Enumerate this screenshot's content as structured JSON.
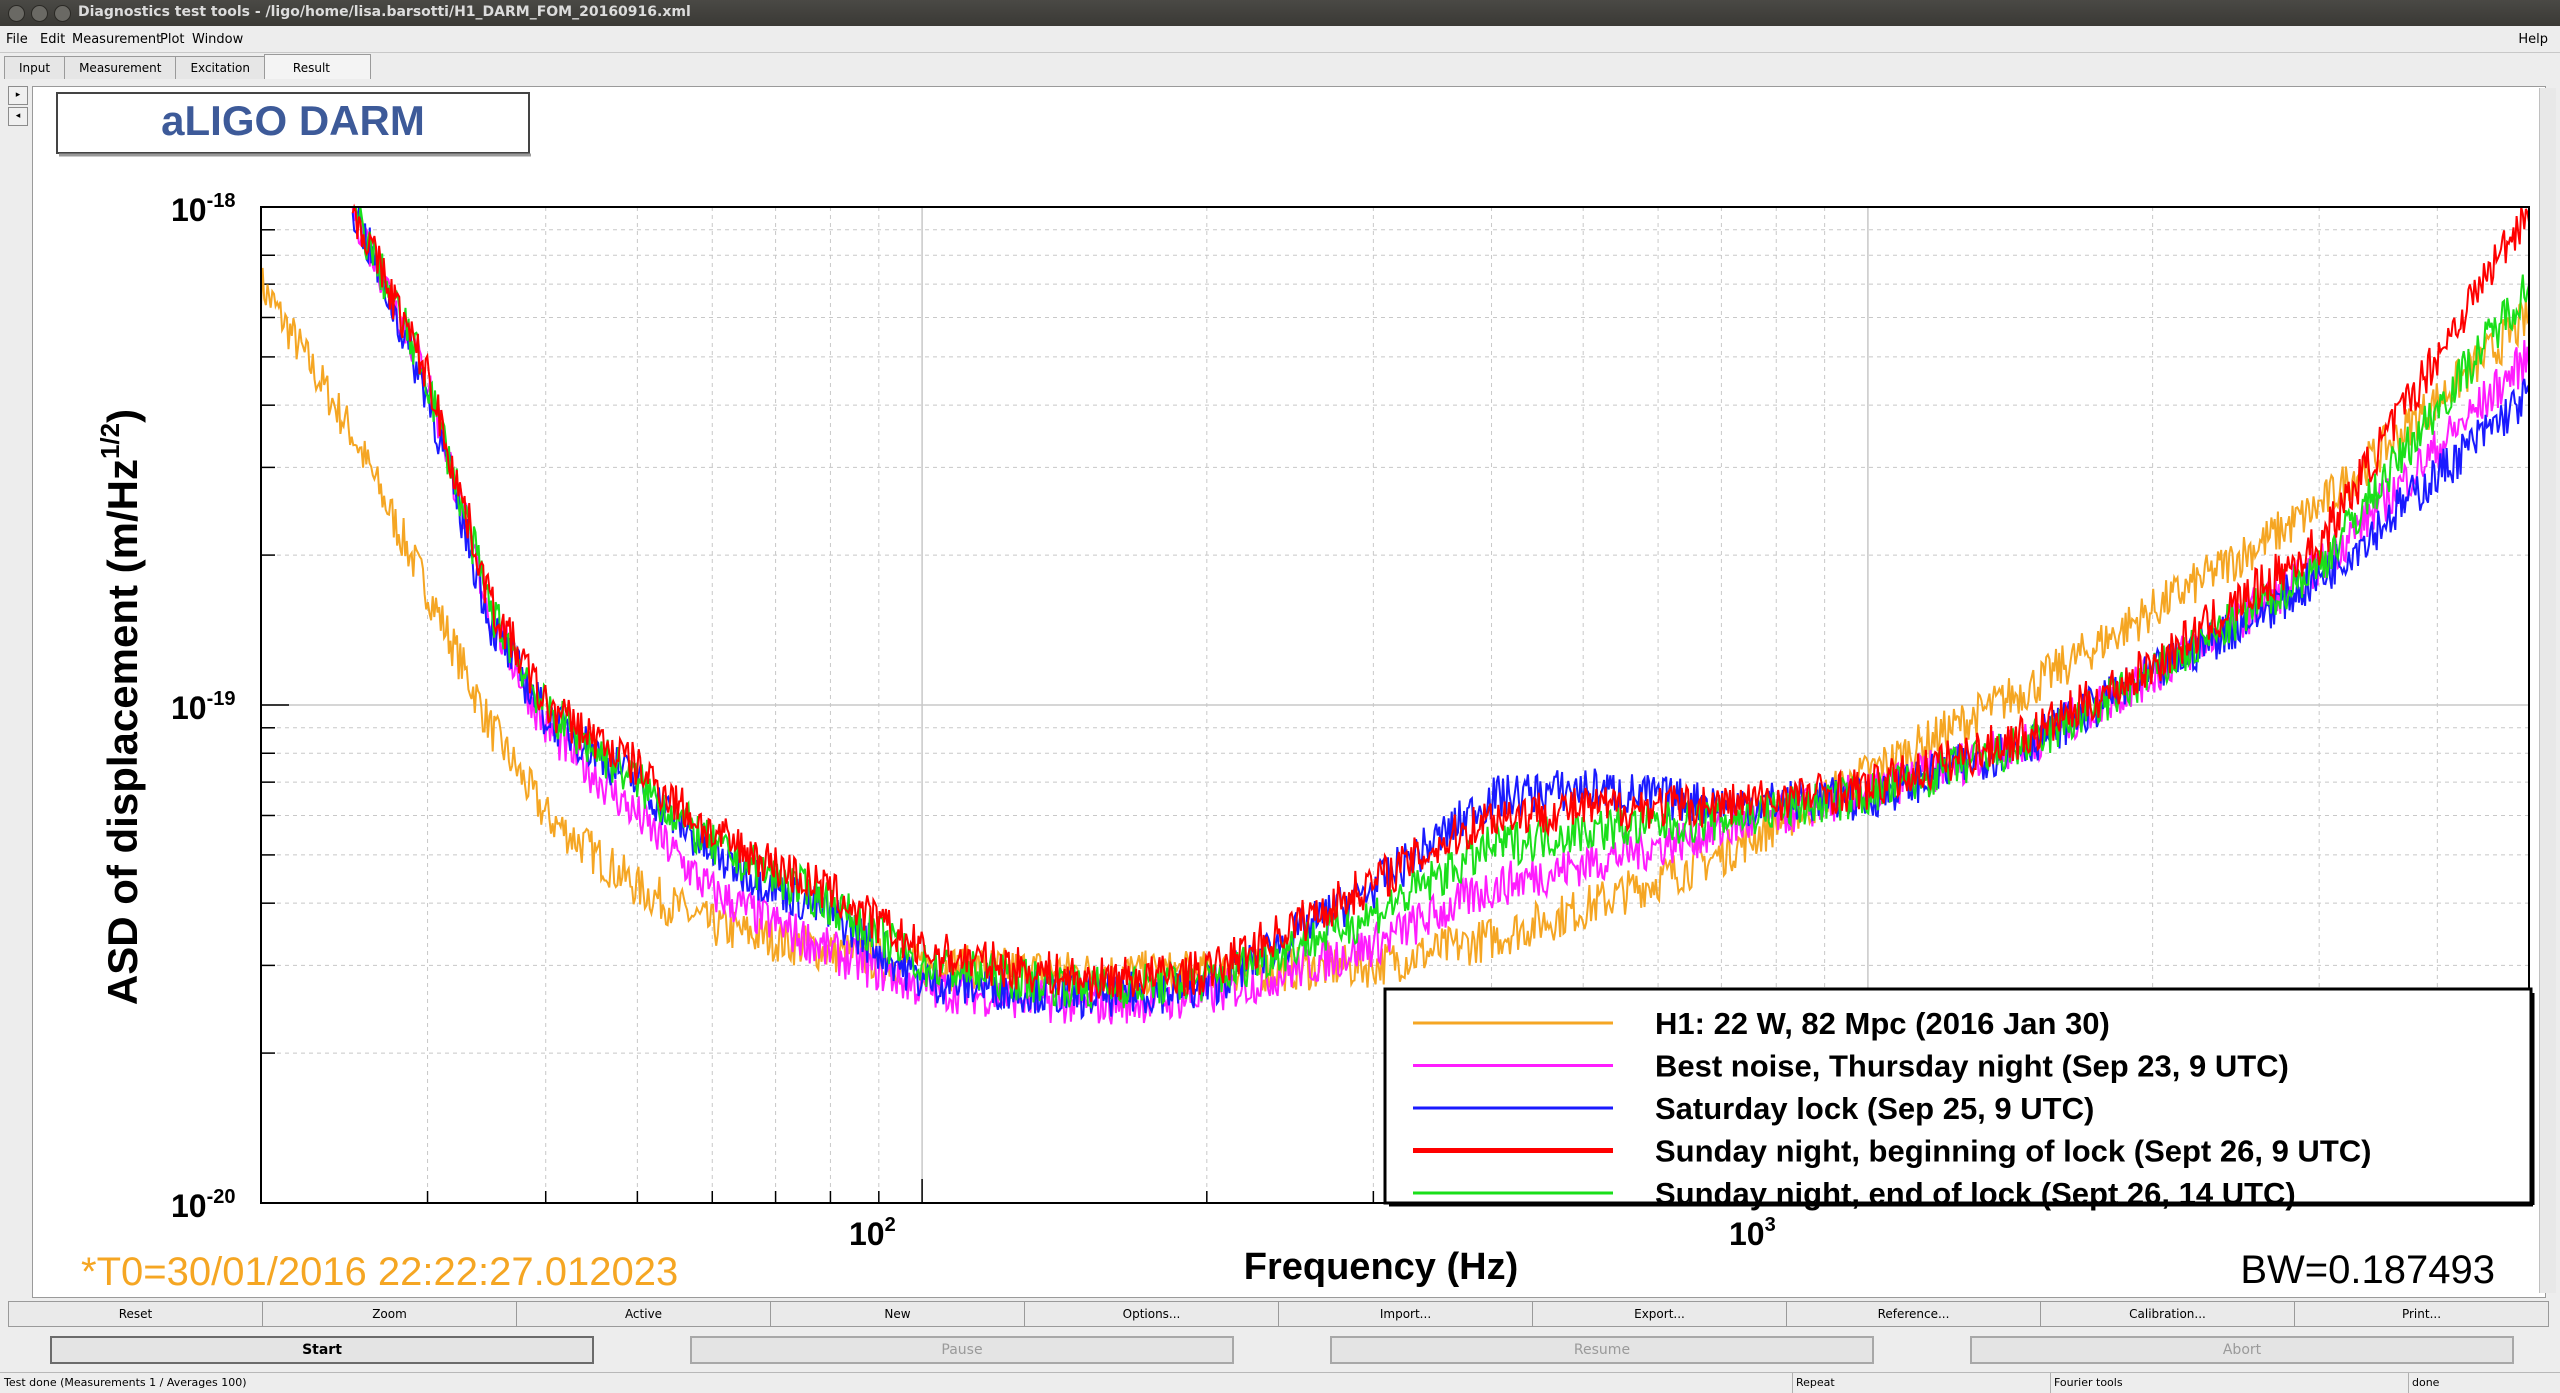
{
  "window": {
    "title": "Diagnostics test tools - /ligo/home/lisa.barsotti/H1_DARM_FOM_20160916.xml"
  },
  "menu": {
    "file": "File",
    "edit": "Edit",
    "measurement": "Measurement",
    "plot": "Plot",
    "window": "Window",
    "help": "Help"
  },
  "tabs": [
    "Input",
    "Measurement",
    "Excitation",
    "Result"
  ],
  "plot": {
    "title": "aLIGO DARM",
    "ylabel": "ASD of displacement (m/Hz",
    "ylabel_sup": "1/2",
    "ylabel_end": ")",
    "xlabel": "Frequency (Hz)",
    "t0": "*T0=30/01/2016 22:22:27.012023",
    "bw": "BW=0.187493",
    "y_ticks": [
      {
        "base": "10",
        "exp": "-18"
      },
      {
        "base": "10",
        "exp": "-19"
      },
      {
        "base": "10",
        "exp": "-20"
      }
    ],
    "x_ticks": [
      {
        "base": "10",
        "exp": "2"
      },
      {
        "base": "10",
        "exp": "3"
      }
    ]
  },
  "chart_data": {
    "type": "line",
    "x_scale": "log",
    "y_scale": "log",
    "xlim": [
      20,
      5000
    ],
    "ylim": [
      1e-20,
      1e-18
    ],
    "grid": true,
    "legend_position": "bottom-right",
    "series": [
      {
        "name": "H1: 22 W, 82 Mpc (2016 Jan 30)",
        "color": "#f5a623",
        "x": [
          20,
          25,
          30,
          35,
          40,
          50,
          60,
          80,
          100,
          150,
          200,
          300,
          400,
          500,
          700,
          1000,
          1500,
          2000,
          3000,
          5000
        ],
        "y": [
          7e-19,
          3.5e-19,
          1.7e-19,
          9e-20,
          6e-20,
          4.3e-20,
          3.6e-20,
          3.2e-20,
          3e-20,
          2.9e-20,
          2.9e-20,
          3e-20,
          3.4e-20,
          3.9e-20,
          5e-20,
          7.3e-20,
          1.1e-19,
          1.55e-19,
          2.5e-19,
          6e-19
        ]
      },
      {
        "name": "Best noise, Thursday night (Sep 23, 9 UTC)",
        "color": "#ff1cff",
        "x": [
          25,
          30,
          35,
          40,
          50,
          60,
          80,
          100,
          150,
          200,
          300,
          400,
          500,
          700,
          1000,
          1500,
          2000,
          3000,
          5000
        ],
        "y": [
          1e-18,
          4.5e-19,
          1.5e-19,
          9e-20,
          6e-20,
          4.2e-20,
          3.2e-20,
          2.7e-20,
          2.5e-20,
          2.6e-20,
          3.3e-20,
          4.3e-20,
          4.8e-20,
          5.6e-20,
          6.7e-20,
          8.5e-20,
          1.15e-19,
          1.9e-19,
          5e-19
        ]
      },
      {
        "name": "Saturday lock (Sep 25, 9 UTC)",
        "color": "#1a1aff",
        "x": [
          25,
          30,
          35,
          40,
          50,
          60,
          80,
          100,
          150,
          200,
          300,
          400,
          500,
          700,
          1000,
          1500,
          2000,
          3000,
          5000
        ],
        "y": [
          1e-18,
          4.2e-19,
          1.45e-19,
          9.5e-20,
          7e-20,
          5e-20,
          3.8e-20,
          2.8e-20,
          2.6e-20,
          2.7e-20,
          4.3e-20,
          6.5e-20,
          6.8e-20,
          6.3e-20,
          6.5e-20,
          8.5e-20,
          1.15e-19,
          1.8e-19,
          4.2e-19
        ]
      },
      {
        "name": "Sunday night, beginning of lock (Sept 26, 9 UTC)",
        "color": "#ff0000",
        "x": [
          25,
          30,
          35,
          40,
          50,
          60,
          80,
          100,
          150,
          200,
          300,
          400,
          500,
          700,
          1000,
          1500,
          2000,
          3000,
          5000
        ],
        "y": [
          1e-18,
          4.6e-19,
          1.6e-19,
          1e-19,
          7.5e-20,
          5.5e-20,
          4.2e-20,
          3.2e-20,
          2.8e-20,
          2.9e-20,
          4.4e-20,
          6e-20,
          6.2e-20,
          6.3e-20,
          6.8e-20,
          8.8e-20,
          1.2e-19,
          2.1e-19,
          1e-18
        ]
      },
      {
        "name": "Sunday night, end of lock (Sept 26, 14 UTC)",
        "color": "#1adf1a",
        "x": [
          25,
          30,
          35,
          40,
          50,
          60,
          80,
          100,
          150,
          200,
          300,
          400,
          500,
          700,
          1000,
          1500,
          2000,
          3000,
          5000
        ],
        "y": [
          1e-18,
          4.5e-19,
          1.55e-19,
          9.8e-20,
          7e-20,
          5.2e-20,
          4e-20,
          3e-20,
          2.7e-20,
          2.8e-20,
          3.8e-20,
          5.2e-20,
          5.6e-20,
          5.9e-20,
          6.6e-20,
          8.4e-20,
          1.15e-19,
          1.9e-19,
          7e-19
        ]
      }
    ]
  },
  "buttons_row1": [
    "Reset",
    "Zoom",
    "Active",
    "New",
    "Options...",
    "Import...",
    "Export...",
    "Reference...",
    "Calibration...",
    "Print..."
  ],
  "buttons_row2": {
    "start": "Start",
    "pause": "Pause",
    "resume": "Resume",
    "abort": "Abort"
  },
  "status": {
    "message": "Test done (Measurements 1 / Averages 100)",
    "repeat": "Repeat",
    "fourier": "Fourier tools",
    "done": "done"
  }
}
